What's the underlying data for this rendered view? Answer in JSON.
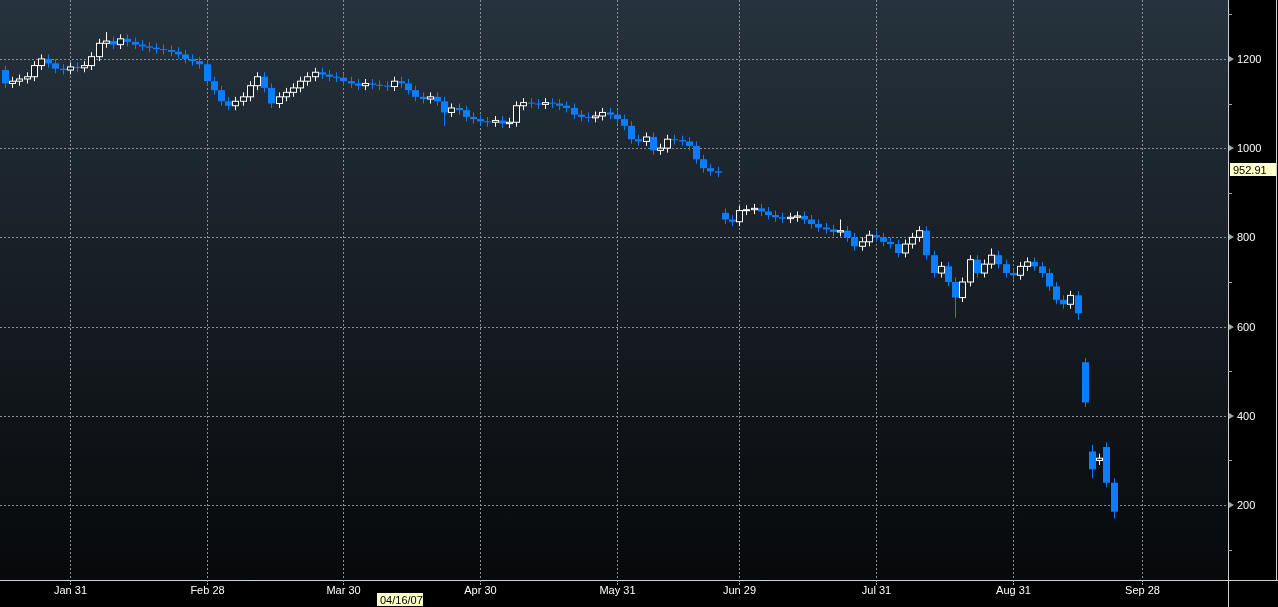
{
  "chart": {
    "chart_data": {
      "type": "candlestick",
      "grid": true,
      "ylim": [
        32,
        1332
      ],
      "categories": [
        null,
        null,
        null,
        null,
        null,
        null,
        null,
        null,
        null,
        "Jan 31",
        null,
        null,
        null,
        null,
        null,
        null,
        null,
        null,
        null,
        null,
        null,
        null,
        null,
        null,
        null,
        null,
        null,
        null,
        "Feb 28",
        null,
        null,
        null,
        null,
        null,
        null,
        null,
        null,
        null,
        null,
        null,
        null,
        null,
        null,
        null,
        null,
        null,
        null,
        "Mar 30",
        null,
        null,
        null,
        null,
        null,
        null,
        null,
        null,
        null,
        null,
        null,
        null,
        null,
        null,
        null,
        null,
        null,
        null,
        "Apr 30",
        null,
        null,
        null,
        null,
        null,
        null,
        null,
        null,
        null,
        null,
        null,
        null,
        null,
        null,
        null,
        null,
        null,
        null,
        "May 31",
        null,
        null,
        null,
        null,
        null,
        null,
        null,
        null,
        null,
        null,
        null,
        null,
        null,
        null,
        null,
        null,
        "Jun 29",
        null,
        null,
        null,
        null,
        null,
        null,
        null,
        null,
        null,
        null,
        null,
        null,
        null,
        null,
        null,
        null,
        null,
        null,
        "Jul 31",
        null,
        null,
        null,
        null,
        null,
        null,
        null,
        null,
        null,
        null,
        null,
        null,
        null,
        null,
        null,
        null,
        null,
        null,
        "Aug 31",
        null,
        null,
        null,
        null,
        null,
        null,
        null,
        null,
        null,
        null,
        null,
        null,
        null,
        null,
        null,
        null,
        null,
        "Sep 28",
        null,
        null,
        null,
        null,
        null,
        null,
        null,
        null,
        null,
        null,
        null
      ],
      "yticks": [
        200,
        400,
        600,
        800,
        1000,
        1200
      ],
      "ohlc": [
        [
          1175,
          1185,
          1135,
          1145
        ],
        [
          1145,
          1160,
          1135,
          1150
        ],
        [
          1150,
          1165,
          1140,
          1155
        ],
        [
          1155,
          1170,
          1145,
          1160
        ],
        [
          1160,
          1195,
          1150,
          1185
        ],
        [
          1185,
          1210,
          1175,
          1200
        ],
        [
          1200,
          1210,
          1180,
          1190
        ],
        [
          1190,
          1200,
          1168,
          1178
        ],
        [
          1178,
          1188,
          1165,
          1175
        ],
        [
          1175,
          1192,
          1165,
          1182
        ],
        [
          1182,
          1192,
          1170,
          1180
        ],
        [
          1180,
          1195,
          1170,
          1185
        ],
        [
          1185,
          1215,
          1175,
          1205
        ],
        [
          1205,
          1245,
          1195,
          1235
        ],
        [
          1235,
          1260,
          1225,
          1240
        ],
        [
          1240,
          1250,
          1222,
          1232
        ],
        [
          1232,
          1255,
          1222,
          1245
        ],
        [
          1245,
          1255,
          1228,
          1238
        ],
        [
          1238,
          1248,
          1222,
          1232
        ],
        [
          1232,
          1242,
          1218,
          1228
        ],
        [
          1228,
          1238,
          1215,
          1225
        ],
        [
          1225,
          1235,
          1212,
          1222
        ],
        [
          1222,
          1232,
          1210,
          1220
        ],
        [
          1220,
          1230,
          1206,
          1216
        ],
        [
          1216,
          1226,
          1200,
          1210
        ],
        [
          1210,
          1220,
          1190,
          1200
        ],
        [
          1200,
          1210,
          1185,
          1195
        ],
        [
          1195,
          1205,
          1178,
          1188
        ],
        [
          1188,
          1198,
          1140,
          1150
        ],
        [
          1150,
          1160,
          1120,
          1130
        ],
        [
          1130,
          1140,
          1095,
          1105
        ],
        [
          1105,
          1115,
          1085,
          1095
        ],
        [
          1095,
          1115,
          1085,
          1105
        ],
        [
          1105,
          1125,
          1095,
          1115
        ],
        [
          1115,
          1150,
          1105,
          1140
        ],
        [
          1140,
          1170,
          1130,
          1160
        ],
        [
          1160,
          1170,
          1125,
          1135
        ],
        [
          1135,
          1145,
          1090,
          1100
        ],
        [
          1100,
          1125,
          1090,
          1115
        ],
        [
          1115,
          1135,
          1105,
          1125
        ],
        [
          1125,
          1145,
          1115,
          1135
        ],
        [
          1135,
          1160,
          1125,
          1150
        ],
        [
          1150,
          1170,
          1140,
          1160
        ],
        [
          1160,
          1180,
          1150,
          1170
        ],
        [
          1170,
          1180,
          1155,
          1165
        ],
        [
          1165,
          1175,
          1150,
          1160
        ],
        [
          1160,
          1170,
          1148,
          1158
        ],
        [
          1158,
          1168,
          1140,
          1150
        ],
        [
          1150,
          1160,
          1135,
          1145
        ],
        [
          1145,
          1155,
          1130,
          1140
        ],
        [
          1140,
          1155,
          1130,
          1145
        ],
        [
          1145,
          1155,
          1132,
          1142
        ],
        [
          1142,
          1152,
          1130,
          1140
        ],
        [
          1140,
          1150,
          1128,
          1138
        ],
        [
          1138,
          1160,
          1128,
          1150
        ],
        [
          1150,
          1160,
          1135,
          1145
        ],
        [
          1145,
          1155,
          1120,
          1130
        ],
        [
          1130,
          1140,
          1105,
          1115
        ],
        [
          1115,
          1125,
          1100,
          1110
        ],
        [
          1110,
          1125,
          1100,
          1115
        ],
        [
          1115,
          1125,
          1095,
          1105
        ],
        [
          1105,
          1115,
          1050,
          1080
        ],
        [
          1080,
          1100,
          1070,
          1090
        ],
        [
          1090,
          1100,
          1075,
          1085
        ],
        [
          1085,
          1095,
          1060,
          1070
        ],
        [
          1070,
          1080,
          1055,
          1065
        ],
        [
          1065,
          1075,
          1050,
          1060
        ],
        [
          1060,
          1070,
          1048,
          1058
        ],
        [
          1058,
          1072,
          1048,
          1062
        ],
        [
          1062,
          1072,
          1045,
          1055
        ],
        [
          1055,
          1068,
          1045,
          1058
        ],
        [
          1058,
          1105,
          1048,
          1095
        ],
        [
          1095,
          1112,
          1085,
          1102
        ],
        [
          1102,
          1112,
          1090,
          1100
        ],
        [
          1100,
          1110,
          1088,
          1098
        ],
        [
          1098,
          1112,
          1088,
          1102
        ],
        [
          1102,
          1112,
          1090,
          1100
        ],
        [
          1100,
          1110,
          1085,
          1095
        ],
        [
          1095,
          1105,
          1080,
          1090
        ],
        [
          1090,
          1100,
          1065,
          1075
        ],
        [
          1075,
          1085,
          1060,
          1070
        ],
        [
          1070,
          1080,
          1058,
          1068
        ],
        [
          1068,
          1082,
          1058,
          1072
        ],
        [
          1072,
          1090,
          1062,
          1080
        ],
        [
          1080,
          1090,
          1065,
          1075
        ],
        [
          1075,
          1085,
          1055,
          1065
        ],
        [
          1065,
          1075,
          1040,
          1050
        ],
        [
          1050,
          1060,
          1010,
          1020
        ],
        [
          1020,
          1030,
          1005,
          1015
        ],
        [
          1015,
          1035,
          1005,
          1025
        ],
        [
          1025,
          1035,
          985,
          995
        ],
        [
          995,
          1010,
          985,
          1000
        ],
        [
          1000,
          1030,
          990,
          1020
        ],
        [
          1020,
          1030,
          1008,
          1018
        ],
        [
          1018,
          1028,
          1005,
          1015
        ],
        [
          1015,
          1025,
          995,
          1005
        ],
        [
          1005,
          1015,
          965,
          975
        ],
        [
          975,
          985,
          945,
          955
        ],
        [
          955,
          965,
          938,
          948
        ],
        [
          948,
          958,
          935,
          945
        ],
        [
          855,
          865,
          830,
          840
        ],
        [
          840,
          850,
          825,
          835
        ],
        [
          835,
          870,
          825,
          860
        ],
        [
          860,
          872,
          850,
          862
        ],
        [
          862,
          875,
          852,
          865
        ],
        [
          865,
          875,
          848,
          858
        ],
        [
          858,
          868,
          840,
          850
        ],
        [
          850,
          860,
          835,
          845
        ],
        [
          845,
          855,
          832,
          842
        ],
        [
          842,
          855,
          832,
          845
        ],
        [
          845,
          858,
          835,
          848
        ],
        [
          848,
          858,
          830,
          840
        ],
        [
          840,
          850,
          820,
          830
        ],
        [
          830,
          840,
          812,
          822
        ],
        [
          822,
          832,
          808,
          818
        ],
        [
          818,
          828,
          802,
          812
        ],
        [
          812,
          840,
          802,
          815
        ],
        [
          815,
          825,
          790,
          800
        ],
        [
          800,
          810,
          770,
          780
        ],
        [
          780,
          800,
          770,
          790
        ],
        [
          790,
          815,
          780,
          805
        ],
        [
          805,
          815,
          790,
          800
        ],
        [
          800,
          810,
          780,
          790
        ],
        [
          790,
          800,
          775,
          785
        ],
        [
          785,
          795,
          755,
          765
        ],
        [
          765,
          795,
          755,
          785
        ],
        [
          785,
          810,
          775,
          800
        ],
        [
          800,
          825,
          790,
          815
        ],
        [
          815,
          825,
          750,
          760
        ],
        [
          760,
          770,
          710,
          720
        ],
        [
          720,
          745,
          710,
          735
        ],
        [
          735,
          745,
          690,
          700
        ],
        [
          700,
          710,
          620,
          665
        ],
        [
          665,
          710,
          655,
          700
        ],
        [
          700,
          760,
          690,
          750
        ],
        [
          750,
          760,
          710,
          720
        ],
        [
          720,
          750,
          710,
          740
        ],
        [
          740,
          775,
          730,
          760
        ],
        [
          760,
          770,
          730,
          740
        ],
        [
          740,
          750,
          710,
          720
        ],
        [
          720,
          730,
          705,
          715
        ],
        [
          715,
          745,
          705,
          735
        ],
        [
          735,
          755,
          725,
          745
        ],
        [
          745,
          755,
          725,
          735
        ],
        [
          735,
          745,
          710,
          720
        ],
        [
          720,
          730,
          680,
          690
        ],
        [
          690,
          700,
          650,
          660
        ],
        [
          660,
          670,
          640,
          650
        ],
        [
          650,
          680,
          640,
          670
        ],
        [
          670,
          680,
          615,
          630
        ],
        [
          520,
          530,
          420,
          430
        ],
        [
          320,
          335,
          260,
          280
        ],
        [
          300,
          315,
          290,
          305
        ],
        [
          330,
          340,
          240,
          250
        ],
        [
          250,
          260,
          170,
          185
        ],
        null,
        null,
        null,
        null,
        null,
        null,
        null,
        null,
        null,
        null,
        null,
        null,
        null,
        null,
        null
      ]
    },
    "last_price_label": "952.91",
    "cursor_date_label": "04/16/07"
  }
}
